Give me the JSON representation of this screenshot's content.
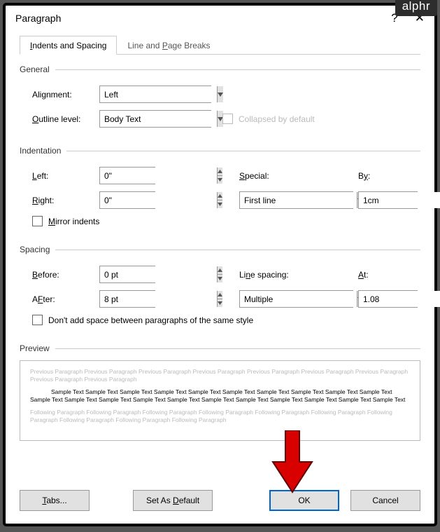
{
  "watermark": "alphr",
  "titlebar": {
    "title": "Paragraph",
    "help": "?",
    "close": "✕"
  },
  "tabs": {
    "t1": "ndents and Spacing",
    "t1_prefix": "I",
    "t2": "Line and ",
    "t2_ul": "P",
    "t2_suffix": "age Breaks"
  },
  "general": {
    "legend": "General",
    "alignment_label": "Alignment:",
    "alignment_value": "Left",
    "outline_label_ul": "O",
    "outline_label_rest": "utline level:",
    "outline_value": "Body Text",
    "collapsed_label": "Collapsed by default"
  },
  "indentation": {
    "legend": "Indentation",
    "left_ul": "L",
    "left_rest": "eft:",
    "left_value": "0\"",
    "right_ul": "R",
    "right_rest": "ight:",
    "right_value": "0\"",
    "special_ul": "S",
    "special_rest": "pecial:",
    "special_value": "First line",
    "by_label_rest": "B",
    "by_ul": "y",
    "by_suffix": ":",
    "by_value": "1cm",
    "mirror_ul": "M",
    "mirror_rest": "irror indents"
  },
  "spacing": {
    "legend": "Spacing",
    "before_ul": "B",
    "before_rest": "efore:",
    "before_value": "0 pt",
    "after_ul": "F",
    "after_pre": "A",
    "after_rest": "ter:",
    "after_value": "8 pt",
    "line_label": "Li",
    "line_ul": "n",
    "line_rest": "e spacing:",
    "line_value": "Multiple",
    "at_ul": "A",
    "at_rest": "t:",
    "at_value": "1.08",
    "noadd_label": "Don't add space between paragraphs of the same style"
  },
  "preview": {
    "legend": "Preview",
    "prev_text": "Previous Paragraph Previous Paragraph Previous Paragraph Previous Paragraph Previous Paragraph Previous Paragraph Previous Paragraph Previous Paragraph Previous Paragraph",
    "sample_text": "Sample Text Sample Text Sample Text Sample Text Sample Text Sample Text Sample Text Sample Text Sample Text Sample Text Sample Text Sample Text Sample Text Sample Text Sample Text Sample Text Sample Text Sample Text Sample Text Sample Text Sample Text",
    "next_text": "Following Paragraph Following Paragraph Following Paragraph Following Paragraph Following Paragraph Following Paragraph Following Paragraph Following Paragraph Following Paragraph Following Paragraph"
  },
  "buttons": {
    "tabs_ul": "T",
    "tabs_rest": "abs...",
    "default_ul": "D",
    "default_pre": "Set As ",
    "default_rest": "efault",
    "ok": "OK",
    "cancel": "Cancel"
  }
}
